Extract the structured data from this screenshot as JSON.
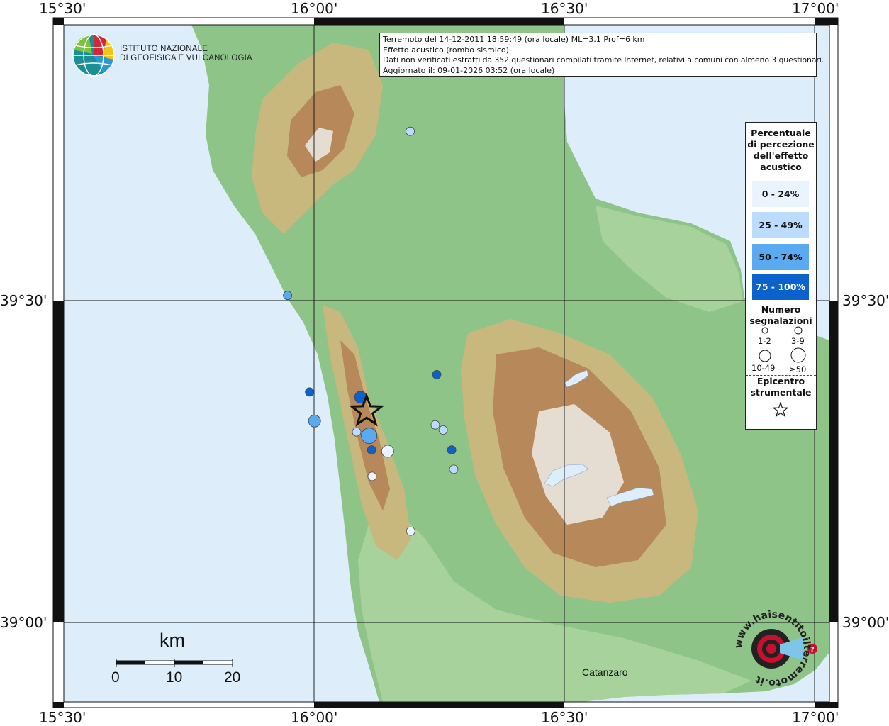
{
  "info": {
    "line1": "Terremoto del 14-12-2011 18:59:49 (ora locale) ML=3.1 Prof=6 km",
    "line2": "Effetto acustico (rombo sismico)",
    "line3": "Dati non verificati estratti da 352 questionari compilati tramite Internet, relativi a comuni con almeno 3 questionari.",
    "line4": "Aggiornato il: 09-01-2026 03:52 (ora locale)"
  },
  "logo": {
    "line1": "ISTITUTO NAZIONALE",
    "line2": "DI GEOFISICA E VULCANOLOGIA"
  },
  "axes": {
    "top": [
      "15°30'",
      "16°00'",
      "16°30'",
      "17°00'"
    ],
    "bottom": [
      "15°30'",
      "16°00'",
      "16°30'",
      "17°00'"
    ],
    "left": [
      "39°30'",
      "39°00'"
    ],
    "right": [
      "39°30'",
      "39°00'"
    ]
  },
  "legend": {
    "title": [
      "Percentuale",
      "di percezione",
      "dell'effetto",
      "acustico"
    ],
    "classes": [
      {
        "label": "0 - 24%",
        "color": "#eaf4ff"
      },
      {
        "label": "25 - 49%",
        "color": "#bcdcff"
      },
      {
        "label": "50 - 74%",
        "color": "#5aaaf2"
      },
      {
        "label": "75 - 100%",
        "color": "#0b62cc"
      }
    ],
    "count_title": [
      "Numero",
      "segnalazioni"
    ],
    "sizes": [
      "1-2",
      "3-9",
      "10-49",
      "≥50"
    ],
    "epicenter_title": [
      "Epicentro",
      "strumentale"
    ]
  },
  "scale": {
    "unit": "km",
    "labels": [
      "0",
      "10",
      "20"
    ]
  },
  "places": {
    "catanzaro": "Catanzaro"
  },
  "watermark": {
    "text": "www.haisentitoilterremoto.it"
  },
  "points": [
    {
      "lat": 39.763,
      "lon": 16.192,
      "class": 1,
      "size": 1
    },
    {
      "lat": 39.508,
      "lon": 15.947,
      "class": 2,
      "size": 1
    },
    {
      "lat": 39.385,
      "lon": 16.245,
      "class": 3,
      "size": 1
    },
    {
      "lat": 39.358,
      "lon": 15.991,
      "class": 3,
      "size": 1
    },
    {
      "lat": 39.35,
      "lon": 16.093,
      "class": 3,
      "size": 2
    },
    {
      "lat": 39.313,
      "lon": 16.001,
      "class": 2,
      "size": 2
    },
    {
      "lat": 39.307,
      "lon": 16.242,
      "class": 1,
      "size": 1
    },
    {
      "lat": 39.299,
      "lon": 16.258,
      "class": 1,
      "size": 1
    },
    {
      "lat": 39.296,
      "lon": 16.085,
      "class": 1,
      "size": 1
    },
    {
      "lat": 39.29,
      "lon": 16.11,
      "class": 2,
      "size": 3
    },
    {
      "lat": 39.268,
      "lon": 16.115,
      "class": 3,
      "size": 1
    },
    {
      "lat": 39.266,
      "lon": 16.147,
      "class": 0,
      "size": 2
    },
    {
      "lat": 39.268,
      "lon": 16.275,
      "class": 3,
      "size": 1
    },
    {
      "lat": 39.238,
      "lon": 16.279,
      "class": 1,
      "size": 1
    },
    {
      "lat": 39.227,
      "lon": 16.116,
      "class": 0,
      "size": 1
    },
    {
      "lat": 39.142,
      "lon": 16.193,
      "class": 0,
      "size": 1
    }
  ],
  "epicenter": {
    "lat": 39.328,
    "lon": 16.105
  }
}
